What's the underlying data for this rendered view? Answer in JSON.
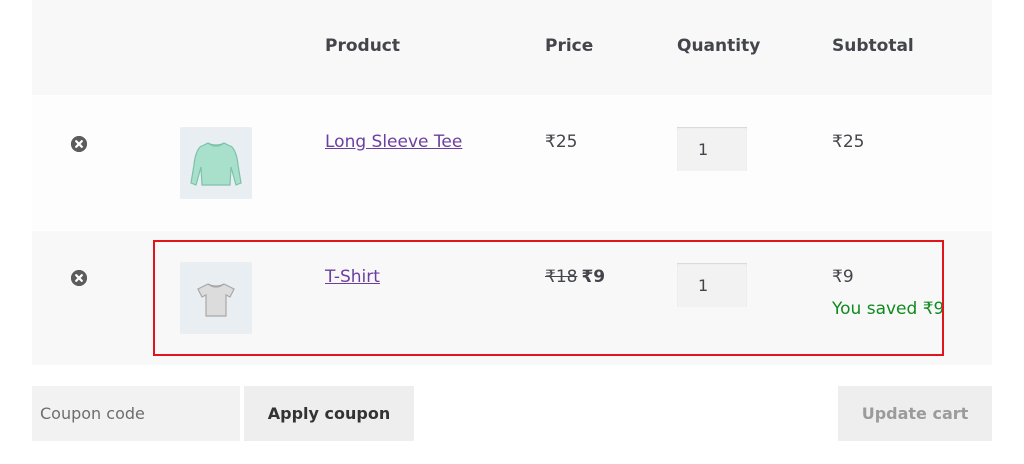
{
  "table": {
    "headers": {
      "product": "Product",
      "price": "Price",
      "quantity": "Quantity",
      "subtotal": "Subtotal"
    },
    "rows": [
      {
        "name": "Long Sleeve Tee",
        "price": "₹25",
        "quantity": "1",
        "subtotal": "₹25",
        "thumbnail_icon": "long-sleeve-tee-icon",
        "thumbnail_color": "#a8e0cc"
      },
      {
        "name": "T-Shirt",
        "price_original": "₹18",
        "price_sale": "₹9",
        "quantity": "1",
        "subtotal": "₹9",
        "savings": "You saved ₹9",
        "thumbnail_icon": "t-shirt-icon",
        "thumbnail_color": "#d9d9d9"
      }
    ]
  },
  "actions": {
    "coupon_placeholder": "Coupon code",
    "apply_coupon_label": "Apply coupon",
    "update_cart_label": "Update cart"
  },
  "colors": {
    "link": "#6b3fa0",
    "savings": "#0f8a1f",
    "highlight_border": "#e0151b"
  }
}
